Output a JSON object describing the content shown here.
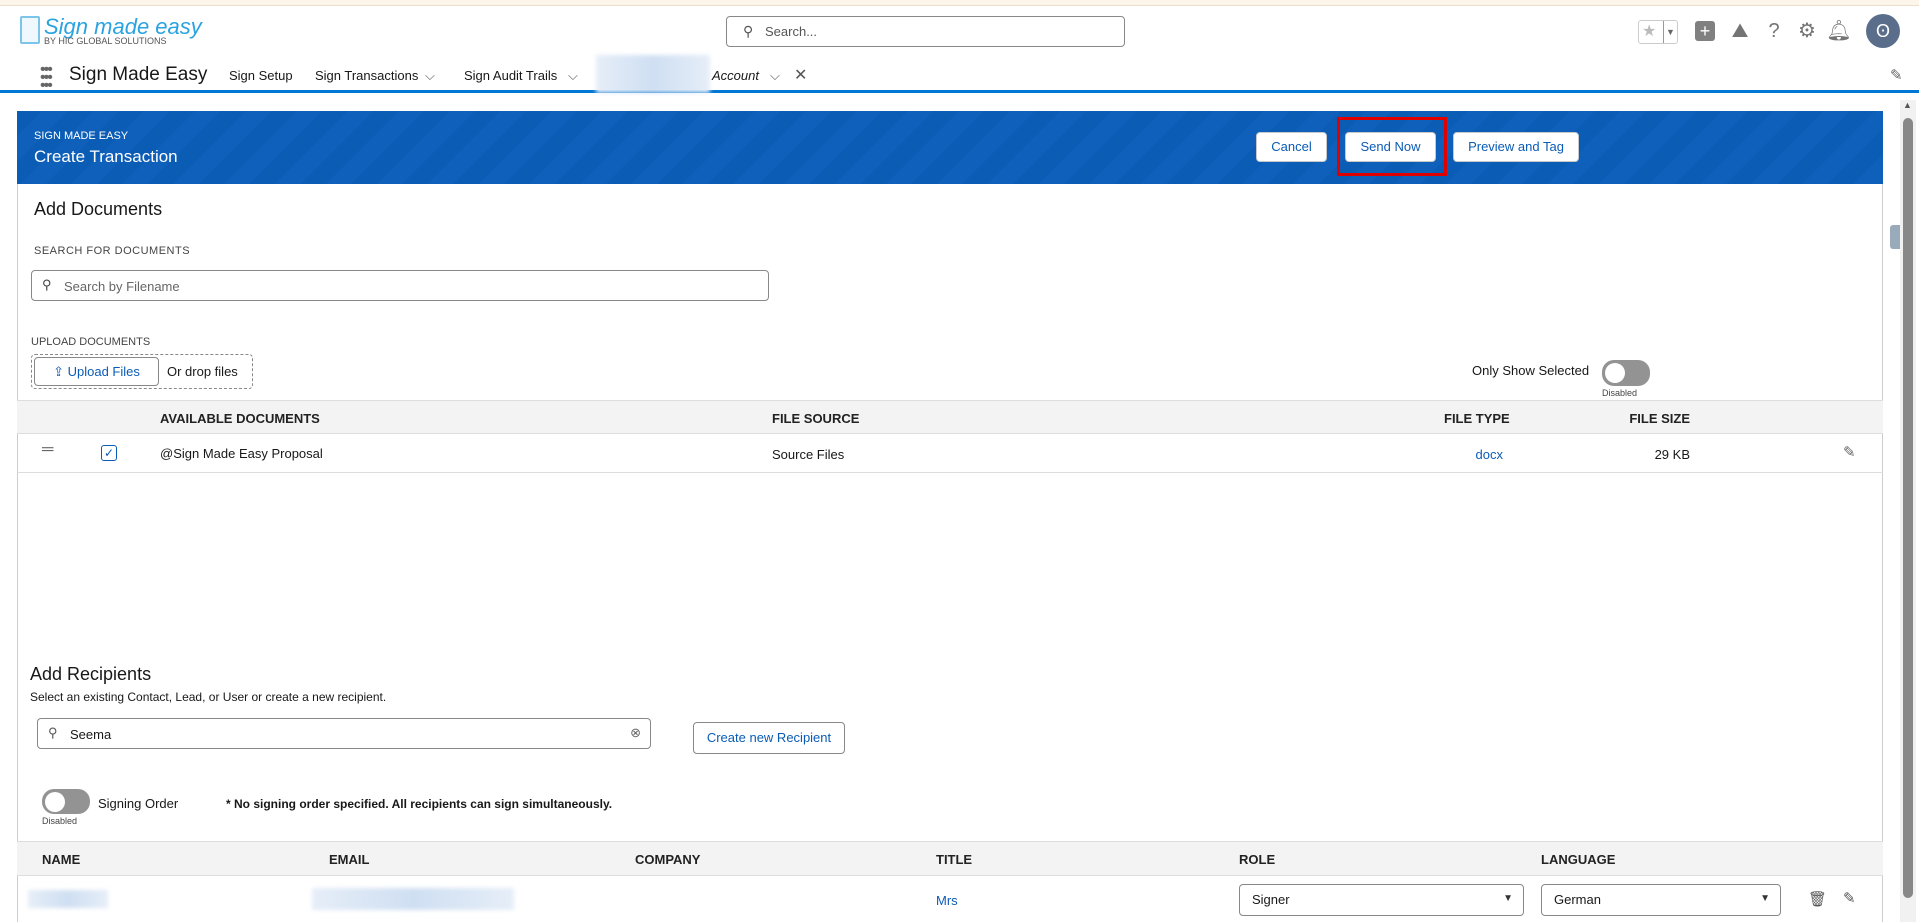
{
  "brand": {
    "logo_title": "Sign made easy",
    "logo_subtitle": "BY HIC GLOBAL SOLUTIONS"
  },
  "global_search": {
    "placeholder": "Search..."
  },
  "nav": {
    "app_name": "Sign Made Easy",
    "items": [
      {
        "label": "Sign Setup"
      },
      {
        "label": "Sign Transactions"
      },
      {
        "label": "Sign Audit Trails"
      }
    ],
    "open_tab": "Account"
  },
  "header": {
    "eyebrow": "SIGN MADE EASY",
    "title": "Create Transaction",
    "cancel": "Cancel",
    "send_now": "Send Now",
    "preview": "Preview and Tag"
  },
  "documents": {
    "title": "Add Documents",
    "search_label": "SEARCH FOR DOCUMENTS",
    "search_placeholder": "Search by Filename",
    "upload_label": "UPLOAD DOCUMENTS",
    "upload_button": "Upload Files",
    "drop_text": "Or drop files",
    "only_selected": "Only Show Selected",
    "toggle_state": "Disabled",
    "columns": [
      "AVAILABLE DOCUMENTS",
      "FILE SOURCE",
      "FILE TYPE",
      "FILE SIZE"
    ],
    "rows": [
      {
        "name": "@Sign Made Easy Proposal",
        "source": "Source Files",
        "type": "docx",
        "size": "29 KB",
        "checked": true
      }
    ]
  },
  "recipients": {
    "title": "Add Recipients",
    "subtitle": "Select an existing Contact, Lead, or User or create a new recipient.",
    "search_value": "Seema",
    "create_button": "Create new Recipient",
    "signing_order": "Signing Order",
    "toggle_state": "Disabled",
    "note": "* No signing order specified. All recipients can sign simultaneously.",
    "columns": [
      "NAME",
      "EMAIL",
      "COMPANY",
      "TITLE",
      "ROLE",
      "LANGUAGE"
    ],
    "rows": [
      {
        "company": "",
        "title": "Mrs",
        "role": "Signer",
        "language": "German"
      }
    ]
  },
  "colors": {
    "brand_blue": "#0b5cb5",
    "highlight": "#e00000"
  }
}
